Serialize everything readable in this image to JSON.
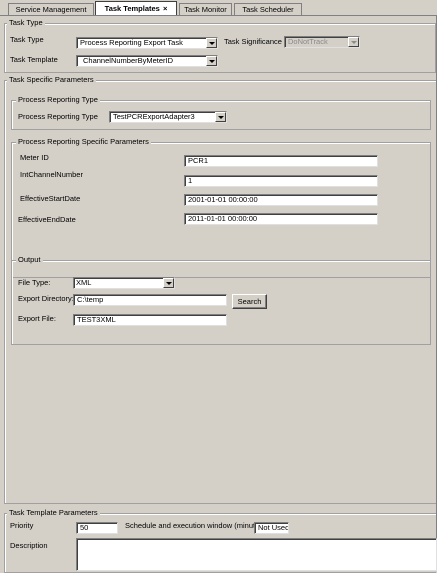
{
  "tabs": [
    {
      "label": "Service Management"
    },
    {
      "label": "Task Templates",
      "close": "×"
    },
    {
      "label": "Task Monitor"
    },
    {
      "label": "Task Scheduler"
    }
  ],
  "task_type_group": {
    "legend": "Task Type",
    "task_type_label": "Task Type",
    "task_type_value": "Process Reporting Export Task",
    "significance_label": "Task Significance",
    "significance_value": "DoNotTrack",
    "template_label": "Task Template",
    "template_value": "ChannelNumberByMeterID"
  },
  "specific_params": {
    "legend": "Task Specific Parameters",
    "process_reporting_type": {
      "legend": "Process Reporting Type",
      "label": "Process Reporting Type",
      "value": "TestPCRExportAdapter3"
    },
    "process_reporting_specific": {
      "legend": "Process Reporting Specific Parameters",
      "fields": [
        {
          "label": "Meter ID",
          "value": "PCR1"
        },
        {
          "label": "IntChannelNumber",
          "value": "1"
        },
        {
          "label": "EffectiveStartDate",
          "value": "2001-01-01 00:00:00"
        },
        {
          "label": "EffectiveEndDate",
          "value": "2011-01-01 00:00:00"
        }
      ]
    },
    "output": {
      "legend": "Output",
      "file_type_label": "File Type:",
      "file_type_value": "XML",
      "export_dir_label": "Export Directory:",
      "export_dir_value": "C:\\temp",
      "search_label": "Search",
      "export_file_label": "Export File:",
      "export_file_value": "TEST3XML"
    }
  },
  "template_params": {
    "legend": "Task Template Parameters",
    "priority_label": "Priority",
    "priority_value": "50",
    "window_label": "Schedule and execution window (minutes)",
    "window_value": "Not Used",
    "description_label": "Description",
    "description_value": ""
  }
}
